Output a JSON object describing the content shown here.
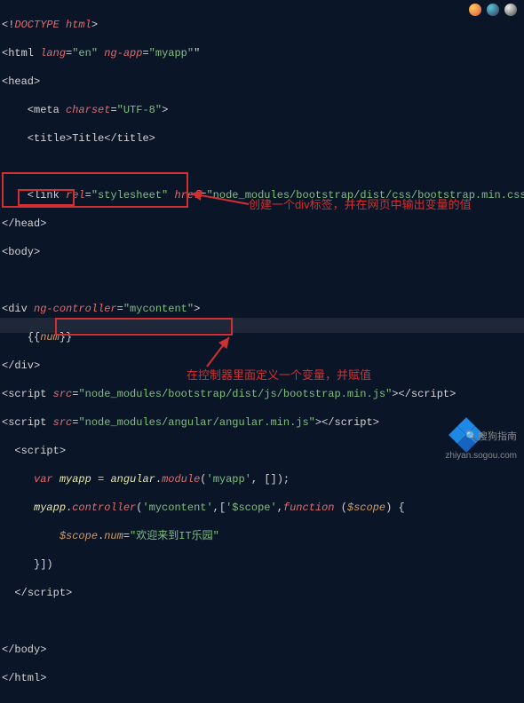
{
  "code": {
    "l1_a": "<!",
    "l1_b": "DOCTYPE",
    "l1_c": " html",
    "l1_d": ">",
    "l2_a": "<",
    "l2_b": "html",
    "l2_c": " lang",
    "l2_d": "=",
    "l2_e": "\"en\"",
    "l2_f": " ng-app",
    "l2_g": "=",
    "l2_h": "\"myapp\"",
    "l2_i": "\"",
    "l3_a": "<",
    "l3_b": "head",
    "l3_c": ">",
    "l4_a": "    <",
    "l4_b": "meta",
    "l4_c": " charset",
    "l4_d": "=",
    "l4_e": "\"UTF-8\"",
    "l4_f": ">",
    "l5_a": "    <",
    "l5_b": "title",
    "l5_c": ">",
    "l5_d": "Title",
    "l5_e": "</",
    "l5_f": "title",
    "l5_g": ">",
    "l6": "",
    "l7_a": "    <",
    "l7_b": "link",
    "l7_c": " rel",
    "l7_d": "=",
    "l7_e": "\"stylesheet\"",
    "l7_f": " href",
    "l7_g": "=",
    "l7_h": "\"node_modules/bootstrap/dist/css/bootstrap.min.css\"",
    "l7_i": ">",
    "l8_a": "</",
    "l8_b": "head",
    "l8_c": ">",
    "l9_a": "<",
    "l9_b": "body",
    "l9_c": ">",
    "l10": "",
    "l11_a": "<",
    "l11_b": "div",
    "l11_c": " ng-controller",
    "l11_d": "=",
    "l11_e": "\"mycontent\"",
    "l11_f": ">",
    "l12_a": "    {{",
    "l12_b": "num",
    "l12_c": "}}",
    "l13_a": "</",
    "l13_b": "div",
    "l13_c": ">",
    "l14_a": "<",
    "l14_b": "script",
    "l14_c": " src",
    "l14_d": "=",
    "l14_e": "\"node_modules/bootstrap/dist/js/bootstrap.min.js\"",
    "l14_f": "></",
    "l14_g": "script",
    "l14_h": ">",
    "l15_a": "<",
    "l15_b": "script",
    "l15_c": " src",
    "l15_d": "=",
    "l15_e": "\"node_modules/angular/angular.min.js\"",
    "l15_f": "></",
    "l15_g": "script",
    "l15_h": ">",
    "l16_a": "  <",
    "l16_b": "script",
    "l16_c": ">",
    "l17_a": "     ",
    "l17_b": "var",
    "l17_c": " myapp",
    "l17_d": " = ",
    "l17_e": "angular",
    "l17_f": ".",
    "l17_g": "module",
    "l17_h": "(",
    "l17_i": "'myapp'",
    "l17_j": ", []);",
    "l18_a": "     ",
    "l18_b": "myapp",
    "l18_c": ".",
    "l18_d": "controller",
    "l18_e": "(",
    "l18_f": "'mycontent'",
    "l18_g": ",[",
    "l18_h": "'$scope'",
    "l18_i": ",",
    "l18_j": "function",
    "l18_k": " (",
    "l18_l": "$scope",
    "l18_m": ") {",
    "l19_a": "         ",
    "l19_b": "$scope",
    "l19_c": ".",
    "l19_d": "num",
    "l19_e": "=",
    "l19_f": "\"欢迎来到IT乐园\"",
    "l20": "     }])",
    "l21_a": "  </",
    "l21_b": "script",
    "l21_c": ">",
    "l22": "",
    "l23_a": "</",
    "l23_b": "body",
    "l23_c": ">",
    "l24_a": "</",
    "l24_b": "html",
    "l24_c": ">"
  },
  "annotations": {
    "a1": "创建一个div标签，并在网页中输出变量的值",
    "a2": "在控制器里面定义一个变量，并赋值"
  },
  "watermarks": {
    "w1": "🔍搜狗指南",
    "w2": "zhiyan.sogou.com"
  }
}
